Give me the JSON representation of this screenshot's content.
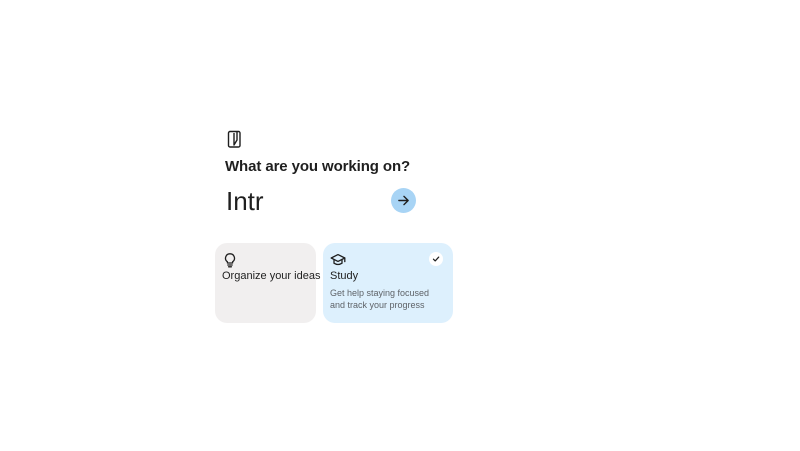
{
  "prompt": {
    "title": "What are you working on?"
  },
  "topic_input": {
    "value": "Intr",
    "placeholder": ""
  },
  "cards": [
    {
      "title": "Organize your ideas",
      "description": "",
      "icon": "lightbulb-icon",
      "selected": false
    },
    {
      "title": "Study",
      "description": "Get help staying focused and track your progress",
      "icon": "graduation-cap-icon",
      "selected": true
    }
  ],
  "colors": {
    "submit_button": "#a8d4f5",
    "card_default": "#f1efef",
    "card_selected": "#ddf0fd"
  },
  "icons": {
    "header": "notebook-icon",
    "submit": "arrow-right-icon",
    "selected_badge": "check-icon"
  }
}
